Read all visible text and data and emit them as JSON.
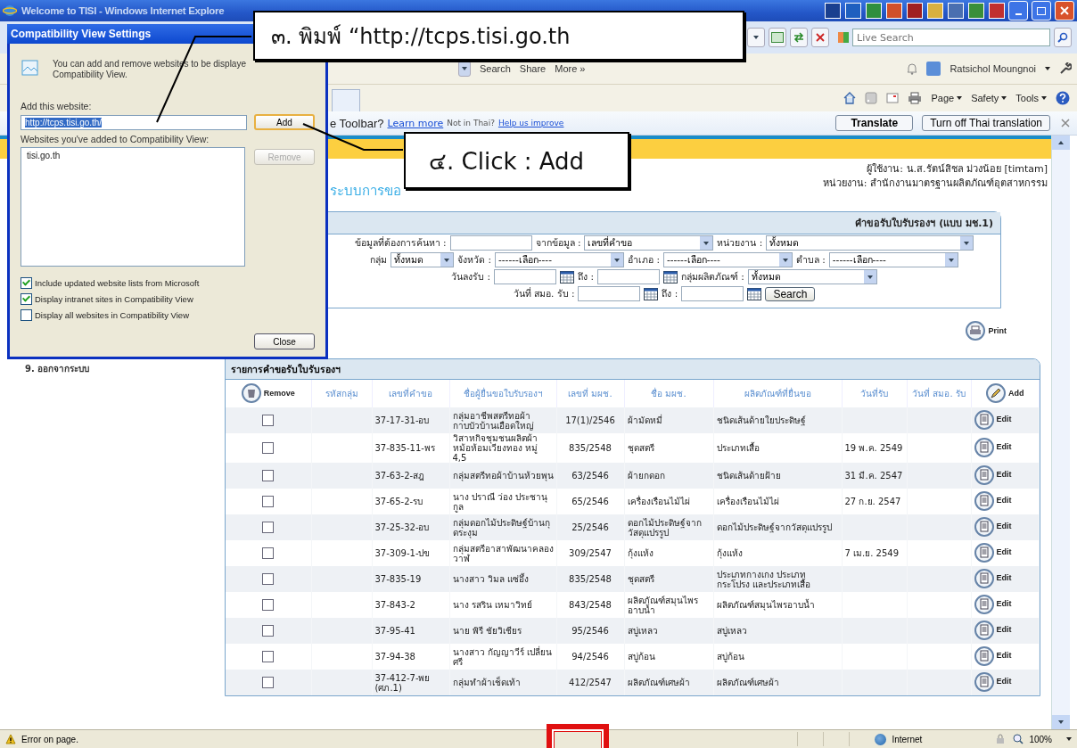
{
  "window": {
    "title": "Welcome to TISI - Windows Internet Explore"
  },
  "address_bar": {
    "search_placeholder": "Live Search"
  },
  "toolbar": {
    "items": [
      "Search",
      "Share",
      "More »"
    ],
    "user": "Ratsichol Moungnoi"
  },
  "command_bar": {
    "items": [
      "Page",
      "Safety",
      "Tools"
    ]
  },
  "translate_bar": {
    "prompt": "e Toolbar?",
    "learn_more": "Learn more",
    "not_in_thai": "Not in Thai?",
    "help": "Help us improve",
    "buttons": [
      "Translate",
      "Turn off Thai translation"
    ]
  },
  "page": {
    "user_line": "ผู้ใช้งาน: น.ส.รัตน์สิชล ม่วงน้อย [timtam]",
    "unit_line": "หน่วยงาน: สำนักงานมาตรฐานผลิตภัณฑ์อุตสาหกรรม",
    "system_title": "ระบบการขอ"
  },
  "sidebar": {
    "items": [
      "9. ออกจากระบบ"
    ]
  },
  "search_form": {
    "title": "คำขอรับใบรับรองฯ (แบบ มช.1)",
    "lines": [
      {
        "fields": [
          {
            "kind": "input",
            "label": "ข้อมูลที่ต้องการค้นหา :"
          },
          {
            "kind": "select",
            "label": "จากข้อมูล :",
            "value": "เลขที่คำขอ"
          },
          {
            "kind": "select",
            "label": "หน่วยงาน :",
            "value": "ทั้งหมด"
          }
        ]
      },
      {
        "fields": [
          {
            "kind": "select",
            "label": "กลุ่ม",
            "value": "ทั้งหมด"
          },
          {
            "kind": "select",
            "label": "จังหวัด :",
            "value": "------เลือก----"
          },
          {
            "kind": "select",
            "label": "อำเภอ :",
            "value": "------เลือก----"
          },
          {
            "kind": "select",
            "label": "ตำบล :",
            "value": "------เลือก----"
          }
        ]
      },
      {
        "fields": [
          {
            "kind": "date",
            "label": "วันลงรับ :"
          },
          {
            "kind": "date",
            "label": "ถึง :"
          },
          {
            "kind": "select",
            "label": "กลุ่มผลิตภัณฑ์ :",
            "value": "ทั้งหมด"
          }
        ]
      },
      {
        "fields": [
          {
            "kind": "date",
            "label": "วันที่ สมอ. รับ :"
          },
          {
            "kind": "date",
            "label": "ถึง :"
          },
          {
            "kind": "button",
            "value": "Search"
          }
        ]
      }
    ]
  },
  "print_button": "Print",
  "table": {
    "title": "รายการคำขอรับใบรับรองฯ",
    "remove_label": "Remove",
    "add_label": "Add",
    "columns": [
      "รหัสกลุ่ม",
      "เลขที่คำขอ",
      "ชื่อผู้ยื่นขอใบรับรองฯ",
      "เลขที่ มผช.",
      "ชื่อ มผช.",
      "ผลิตภัณฑ์ที่ยื่นขอ",
      "วันที่รับ",
      "วันที่ สมอ. รับ"
    ],
    "rows": [
      {
        "checked": false,
        "request_no": "37-17-31-อบ",
        "applicant": "กลุ่มอาชีพสตรีทอผ้ากาบบัวบ้านเอือดใหญ่",
        "std_no": "17(1)/2546",
        "std_name": "ผ้ามัดหมี่",
        "product": "ชนิดเส้นด้ายใยประดิษฐ์",
        "edit": "Edit"
      },
      {
        "checked": false,
        "request_no": "37-835-11-พร",
        "applicant": "วิสาหกิจชุมชนผลิตผ้าหม้อห้อมเวียงทอง หมู่ 4,5",
        "std_no": "835/2548",
        "std_name": "ชุดสตรี",
        "product": "ประเภทเสื้อ",
        "received": "19 พ.ค. 2549",
        "edit": "Edit"
      },
      {
        "checked": false,
        "request_no": "37-63-2-สฎ",
        "applicant": "กลุ่มสตรีทอผ้าบ้านห้วยพุน",
        "std_no": "63/2546",
        "std_name": "ผ้ายกดอก",
        "product": "ชนิดเส้นด้ายฝ้าย",
        "received": "31 มี.ค. 2547",
        "edit": "Edit"
      },
      {
        "checked": false,
        "request_no": "37-65-2-รบ",
        "applicant": "นาง ปราณี ว่อง ประชานุกูล",
        "std_no": "65/2546",
        "std_name": "เครื่องเรือนไม้ไผ่",
        "product": "เครื่องเรือนไม้ไผ่",
        "received": "27 ก.ย. 2547",
        "edit": "Edit"
      },
      {
        "checked": false,
        "request_no": "37-25-32-อบ",
        "applicant": "กลุ่มดอกไม้ประดิษฐ์บ้านกุดระงุม",
        "std_no": "25/2546",
        "std_name": "ดอกไม้ประดิษฐ์จากวัสดุแปรรูป",
        "product": "ดอกไม้ประดิษฐ์จากวัสดุแปรรูป",
        "edit": "Edit"
      },
      {
        "checked": false,
        "request_no": "37-309-1-ปข",
        "applicant": "กลุ่มสตรีอาสาพัฒนาคลองวาฬ",
        "std_no": "309/2547",
        "std_name": "กุ้งแห้ง",
        "product": "กุ้งแห้ง",
        "received": "7 เม.ย. 2549",
        "edit": "Edit"
      },
      {
        "checked": false,
        "request_no": "37-835-19",
        "applicant": "นางสาว วิมล แซ่อึ้ง",
        "std_no": "835/2548",
        "std_name": "ชุดสตรี",
        "product": "ประเภทกางเกง ประเภทกระโปรง และประเภทเสื้อ",
        "edit": "Edit"
      },
      {
        "checked": false,
        "request_no": "37-843-2",
        "applicant": "นาง รสริน เหมาวิทย์",
        "std_no": "843/2548",
        "std_name": "ผลิตภัณฑ์สมุนไพรอาบน้ำ",
        "product": "ผลิตภัณฑ์สมุนไพรอาบน้ำ",
        "edit": "Edit"
      },
      {
        "checked": false,
        "request_no": "37-95-41",
        "applicant": "นาย พิรี ชัยวิเชียร",
        "std_no": "95/2546",
        "std_name": "สบู่เหลว",
        "product": "สบู่เหลว",
        "edit": "Edit"
      },
      {
        "checked": false,
        "request_no": "37-94-38",
        "applicant": "นางสาว กัญญาวีร์ เปลี่ยนศรี",
        "std_no": "94/2546",
        "std_name": "สบู่ก้อน",
        "product": "สบู่ก้อน",
        "edit": "Edit"
      },
      {
        "checked": false,
        "request_no": "37-412-7-พย (ศภ.1)",
        "applicant": "กลุ่มทำผ้าเช็ดเท้า",
        "std_no": "412/2547",
        "std_name": "ผลิตภัณฑ์เศษผ้า",
        "product": "ผลิตภัณฑ์เศษผ้า",
        "edit": "Edit"
      }
    ]
  },
  "dialog": {
    "title": "Compatibility View Settings",
    "intro_lines": [
      "You can add and remove websites to be displaye",
      "Compatibility View."
    ],
    "add_label": "Add this website:",
    "url_value": "http://tcps.tisi.go.th/",
    "add_button": "Add",
    "list_label": "Websites you've added to Compatibility View:",
    "sites": [
      "tisi.go.th"
    ],
    "remove_button": {
      "label": "Remove",
      "disabled": true
    },
    "options": [
      {
        "label": "Include updated website lists from Microsoft",
        "checked": true
      },
      {
        "label": "Display intranet sites in Compatibility View",
        "checked": true
      },
      {
        "label": "Display all websites in Compatibility View",
        "checked": false
      }
    ],
    "close_button": "Close"
  },
  "callouts": [
    "๓. พิมพ์ “http://tcps.tisi.go.th",
    "๔. Click : Add"
  ],
  "status_bar": {
    "message": "Error on page.",
    "zone": "Internet",
    "zoom": "100%"
  }
}
